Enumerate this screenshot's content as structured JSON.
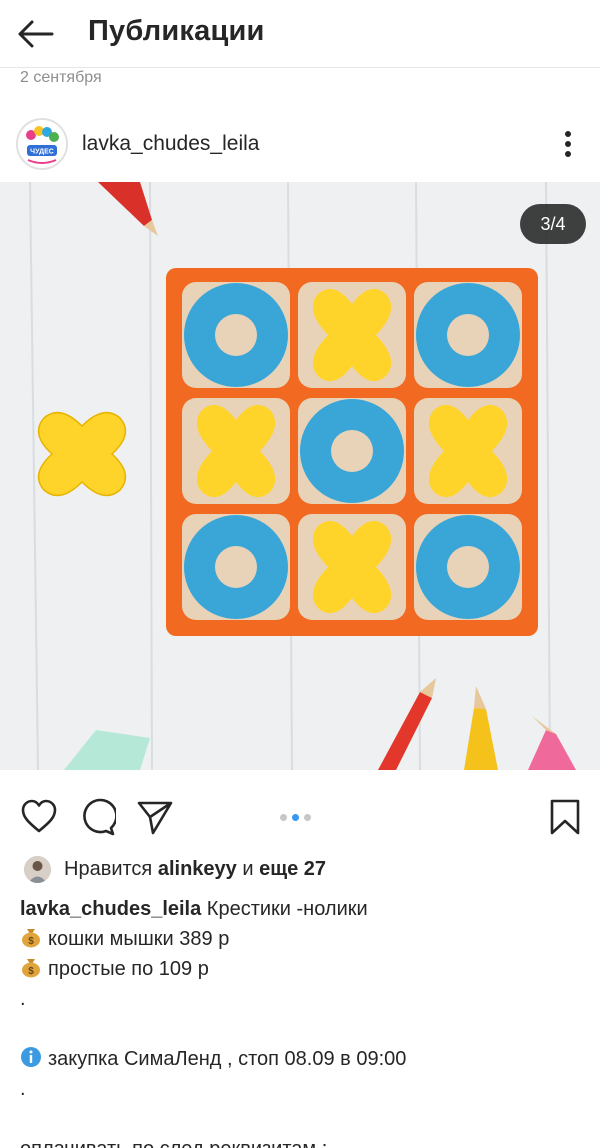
{
  "header": {
    "title": "Публикации"
  },
  "post": {
    "date": "2 сентября",
    "username": "lavka_chudes_leila",
    "avatar_text": "ЧУДЕС",
    "photo": {
      "counter": "3/4",
      "board_color": "#f26a21",
      "o_color": "#3aa6d8",
      "x_color": "#ffd42a"
    },
    "carousel": {
      "count": 3,
      "active": 2
    },
    "likes": {
      "prefix": "Нравится",
      "user": "alinkeyy",
      "joiner": "и",
      "others": "еще 27"
    },
    "caption": {
      "user": "lavka_chudes_leila",
      "lines": [
        "Крестики -нолики",
        "кошки мышки 389  р",
        "простые по 109 р",
        ".",
        "",
        "закупка СимаЛенд , стоп 08.09 в 09:00",
        ".",
        "",
        "оплачивать по след реквизитам :"
      ]
    }
  },
  "colors": {
    "text": "#262626",
    "secondary": "#8e8e8e",
    "dot_active": "#3897f0",
    "dot_inactive": "#c7c7c7"
  }
}
